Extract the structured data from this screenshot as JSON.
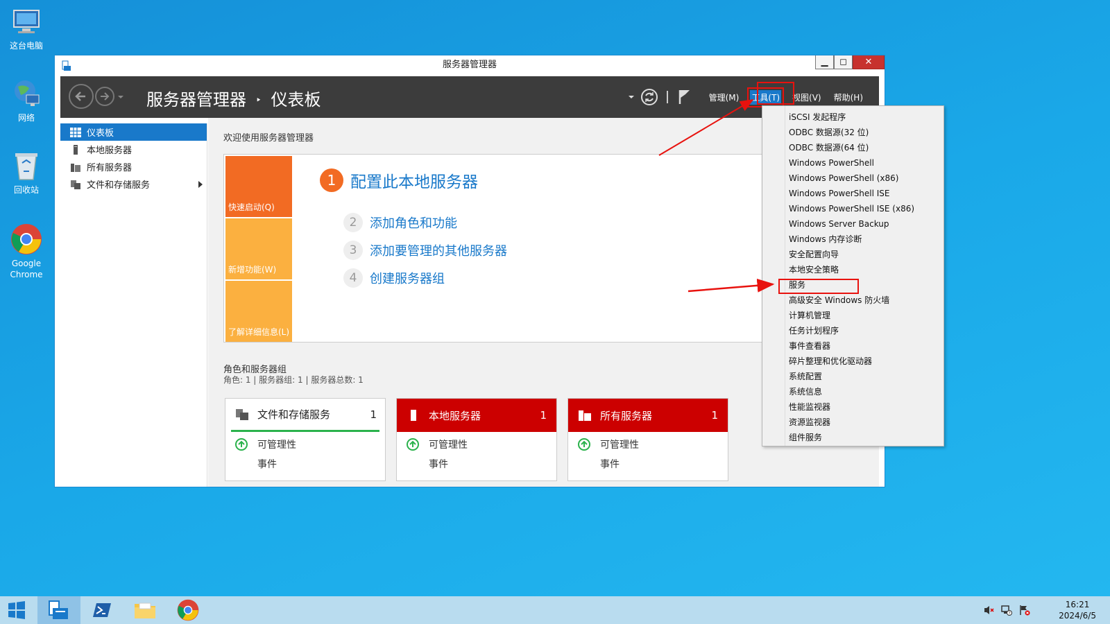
{
  "desktop": {
    "icons": [
      {
        "label": "这台电脑"
      },
      {
        "label": "网络"
      },
      {
        "label": "回收站"
      },
      {
        "label": "Google Chrome"
      }
    ]
  },
  "window": {
    "title": "服务器管理器",
    "breadcrumb_app": "服务器管理器",
    "breadcrumb_sep": "‣",
    "breadcrumb_page": "仪表板",
    "min_glyph": "▁",
    "max_glyph": "◻",
    "close_glyph": "✕",
    "menu": [
      "管理(M)",
      "工具(T)",
      "视图(V)",
      "帮助(H)"
    ],
    "accent": "#1979ca"
  },
  "sidebar": {
    "items": [
      {
        "label": "仪表板"
      },
      {
        "label": "本地服务器"
      },
      {
        "label": "所有服务器"
      },
      {
        "label": "文件和存储服务"
      }
    ]
  },
  "main": {
    "welcome": "欢迎使用服务器管理器",
    "tiles": [
      "快速启动(Q)",
      "新增功能(W)",
      "了解详细信息(L)"
    ],
    "steps": [
      {
        "num": "1",
        "text": "配置此本地服务器"
      },
      {
        "num": "2",
        "text": "添加角色和功能"
      },
      {
        "num": "3",
        "text": "添加要管理的其他服务器"
      },
      {
        "num": "4",
        "text": "创建服务器组"
      }
    ],
    "roles_title": "角色和服务器组",
    "roles_sub": "角色: 1 | 服务器组: 1 | 服务器总数: 1",
    "cards": [
      {
        "title": "文件和存储服务",
        "count": "1",
        "line1": "可管理性",
        "line2": "事件"
      },
      {
        "title": "本地服务器",
        "count": "1",
        "line1": "可管理性",
        "line2": "事件"
      },
      {
        "title": "所有服务器",
        "count": "1",
        "line1": "可管理性",
        "line2": "事件"
      }
    ]
  },
  "tools_menu": {
    "items": [
      "iSCSI 发起程序",
      "ODBC 数据源(32 位)",
      "ODBC 数据源(64 位)",
      "Windows PowerShell",
      "Windows PowerShell (x86)",
      "Windows PowerShell ISE",
      "Windows PowerShell ISE (x86)",
      "Windows Server Backup",
      "Windows 内存诊断",
      "安全配置向导",
      "本地安全策略",
      "服务",
      "高级安全 Windows 防火墙",
      "计算机管理",
      "任务计划程序",
      "事件查看器",
      "碎片整理和优化驱动器",
      "系统配置",
      "系统信息",
      "性能监视器",
      "资源监视器",
      "组件服务"
    ]
  },
  "taskbar": {
    "time": "16:21",
    "date": "2024/6/5"
  }
}
